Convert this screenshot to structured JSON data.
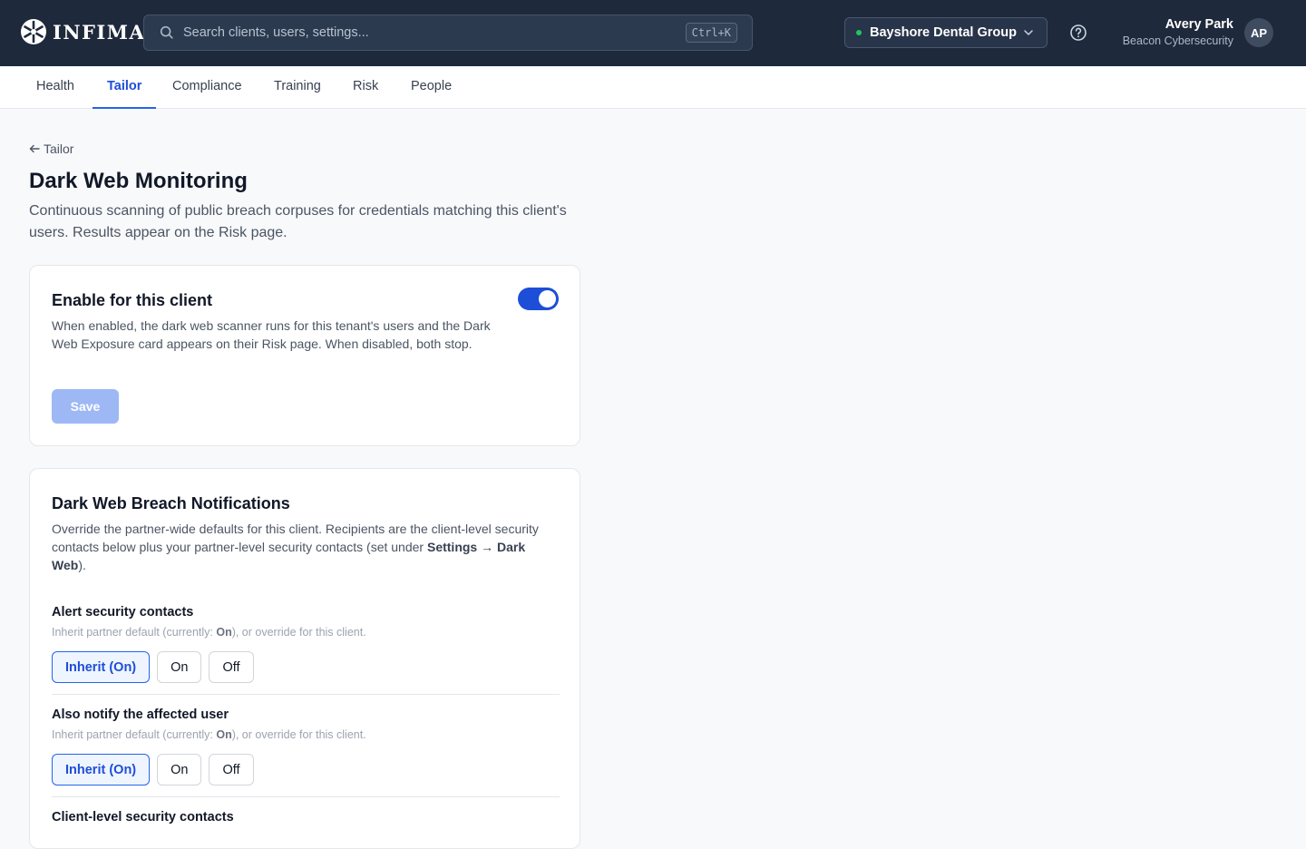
{
  "brand": {
    "name": "INFIMA"
  },
  "search": {
    "placeholder": "Search clients, users, settings...",
    "shortcut": "Ctrl+K"
  },
  "client_switcher": {
    "name": "Bayshore Dental Group"
  },
  "user": {
    "name": "Avery Park",
    "org": "Beacon Cybersecurity",
    "initials": "AP"
  },
  "tabs": [
    {
      "label": "Health"
    },
    {
      "label": "Tailor",
      "active": true
    },
    {
      "label": "Compliance"
    },
    {
      "label": "Training"
    },
    {
      "label": "Risk"
    },
    {
      "label": "People"
    }
  ],
  "breadcrumb": {
    "back_label": "Tailor"
  },
  "page": {
    "title": "Dark Web Monitoring",
    "description": "Continuous scanning of public breach corpuses for credentials matching this client's users. Results appear on the Risk page."
  },
  "enable_card": {
    "title": "Enable for this client",
    "description": "When enabled, the dark web scanner runs for this tenant's users and the Dark Web Exposure card appears on their Risk page. When disabled, both stop.",
    "enabled": true,
    "save_label": "Save"
  },
  "notifications_card": {
    "title": "Dark Web Breach Notifications",
    "desc_part1": "Override the partner-wide defaults for this client. Recipients are the client-level security contacts below plus your partner-level security contacts (set under ",
    "desc_settings": "Settings",
    "desc_arrow": " → ",
    "desc_darkweb": "Dark Web",
    "desc_end": ").",
    "settings": [
      {
        "label": "Alert security contacts",
        "hint_prefix": "Inherit partner default (currently: ",
        "hint_value": "On",
        "hint_suffix": "), or override for this client.",
        "options": [
          "Inherit (On)",
          "On",
          "Off"
        ],
        "selected": "Inherit (On)"
      },
      {
        "label": "Also notify the affected user",
        "hint_prefix": "Inherit partner default (currently: ",
        "hint_value": "On",
        "hint_suffix": "), or override for this client.",
        "options": [
          "Inherit (On)",
          "On",
          "Off"
        ],
        "selected": "Inherit (On)"
      }
    ],
    "next_section_label": "Client-level security contacts"
  },
  "colors": {
    "topbar": "#1e293b",
    "accent": "#2563eb",
    "status_online": "#22c55e"
  }
}
